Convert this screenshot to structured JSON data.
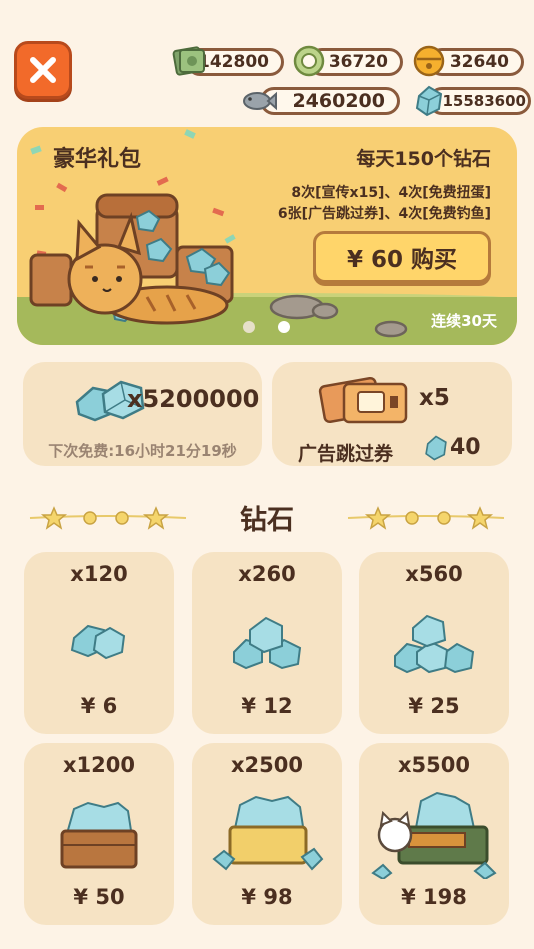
{
  "currencies": {
    "cash": "142800",
    "coin": "36720",
    "bell": "32640",
    "fish": "2460200",
    "diamond": "15583600"
  },
  "banner": {
    "title": "豪华礼包",
    "subtitle": "每天150个钻石",
    "line1": "8次[宣传x15]、4次[免费扭蛋]",
    "line2": "6张[广告跳过券]、4次[免费钓鱼]",
    "buy_label": "¥ 60 购买",
    "streak": "连续30天",
    "page_indicator": {
      "current": 2,
      "total": 2
    }
  },
  "free_offer": {
    "amount": "x5200000",
    "timer": "下次免费:16小时21分19秒"
  },
  "ad_skip_offer": {
    "count": "x5",
    "label": "广告跳过券",
    "price": "40"
  },
  "section": {
    "title": "钻石"
  },
  "packs": [
    {
      "qty": "x120",
      "price": "¥ 6"
    },
    {
      "qty": "x260",
      "price": "¥ 12"
    },
    {
      "qty": "x560",
      "price": "¥ 25"
    },
    {
      "qty": "x1200",
      "price": "¥ 50"
    },
    {
      "qty": "x2500",
      "price": "¥ 98"
    },
    {
      "qty": "x5500",
      "price": "¥ 198"
    }
  ],
  "colors": {
    "background": "#fdf3e6",
    "card": "#f6e3c4",
    "banner": "#f8cf73",
    "close_button": "#f26a2a",
    "diamond": "#8ccfd9"
  },
  "icons": {
    "close": "close-icon",
    "cash": "cash-icon",
    "coin": "coin-icon",
    "bell": "bell-icon",
    "fish": "fish-icon",
    "diamond": "diamond-icon",
    "ticket": "ticket-icon"
  }
}
